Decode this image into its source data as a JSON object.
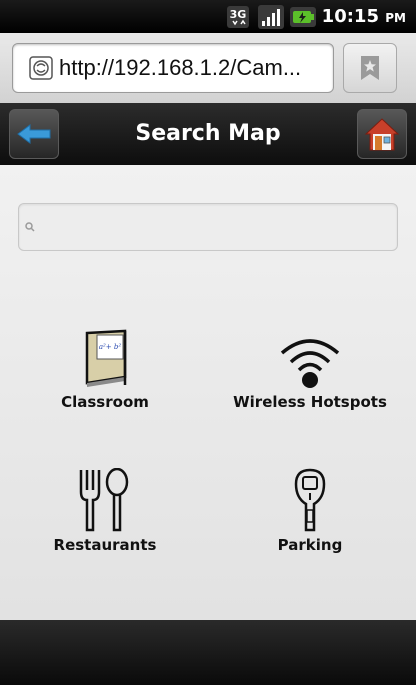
{
  "status_bar": {
    "network_label": "3G",
    "time": "10:15",
    "ampm": "PM",
    "icons": [
      "3g-icon",
      "signal-icon",
      "battery-charging-icon"
    ]
  },
  "browser": {
    "url": "http://192.168.1.2/Cam...",
    "bookmark_icon": "bookmark-star-icon"
  },
  "header": {
    "title": "Search Map",
    "back_icon": "back-arrow-icon",
    "home_icon": "home-icon"
  },
  "search": {
    "placeholder": "",
    "value": ""
  },
  "categories": [
    {
      "label": "Classroom",
      "icon": "classroom-icon"
    },
    {
      "label": "Wireless Hotspots",
      "icon": "wifi-icon"
    },
    {
      "label": "Restaurants",
      "icon": "fork-spoon-icon"
    },
    {
      "label": "Parking",
      "icon": "parking-meter-icon"
    }
  ],
  "colors": {
    "back_arrow": "#3a9ad9",
    "battery": "#5bbf2a",
    "home_roof": "#c8402a"
  }
}
